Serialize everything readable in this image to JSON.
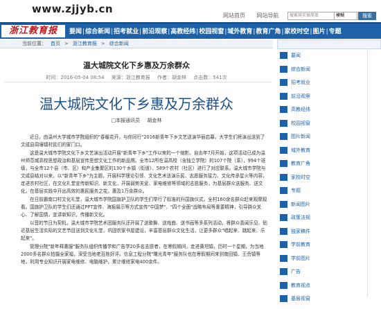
{
  "header": {
    "url_text": "www.zjjyb.cn",
    "links": [
      "网站首页",
      "网站导航"
    ],
    "search_placeholder": "搜索其实很简单",
    "search_select": "模糊",
    "search_button": "搜索"
  },
  "nav": {
    "logo_text": "浙江教育报",
    "items": [
      "要闻",
      "综合新闻",
      "招考就业",
      "前沿观察",
      "高教经纬",
      "校园视窗",
      "域外教育",
      "教育广角",
      "家校时空",
      "图片",
      "专题"
    ]
  },
  "breadcrumb": {
    "prefix": "当前位置：",
    "items": [
      "首页",
      ">",
      "浙江教育报",
      ">",
      "综合新闻"
    ]
  },
  "article": {
    "title_small": "温大城院文化下乡惠及万余群众",
    "meta": {
      "time": "时间：2016-05-04 08:54",
      "source": "来源：浙江教育报",
      "author": "作者：胡金林",
      "views": "点击数：541次"
    },
    "title_large": "温大城院文化下乡惠及万余群众",
    "byline": {
      "reporter": "□本报通讯员",
      "name": "胡金林"
    },
    "paragraphs": [
      "近日，由温州大学城市学院组织的\"春暖花开，与你同行\"2016新青年下乡文艺送演华丽启幕，大学生们将演出送到了文成县周壤镇村民们的家门口。",
      "这是温大城市学院文化下乡文艺演出活动开展\"新青年下乡\"工作以来的一个缩影。自去年7月开始，这项活动已成为温州师范城高校思想政治和基层宣传思想文化工作的新品牌。全市12所在温高校（含独立学院）的107个院（系），994个班级，与全市12个县（市、区）和产业集聚区的130个乡镇（街道）、589个农村（社区）进行了对应联系。温大城市学院与文成县结对以来，以\"新青年下乡\"为主题，开展科学理论引领、文化艺术送演乐民、志愿服务接力、文化传承星火等内容，走进农村社区，在文化礼堂宣传新知识、新文化，开展弱势关爱、家电维修等领域的志愿服务，为基层群众送服务、送文化，在基层实践中开出高效的惠民服务之花，惠及1万余群众。",
      "在日前霸南口村文化礼堂，温大城市学院国旗护卫队的学生们举行了标准的升国旗仪式，全村160余名群众赶来观摩观看。国旗护卫队的学生们还通过PPT宣传、海报展示等方式宣传\"中国梦\"、\"四个全面\"战略布局等重要精神，引导群众关心、了解国情，宣讲新知识，传播新文化。",
      "以音的节日为契机，温大城市学院艺术团服务队还开展了送歌舞、送戏曲、送书画等多系列活动，将群众喜闻乐见、贴近基层生活实际的文艺节目送到文化礼堂，巩固农家书屋建设，丰富基层群众文化生活，让更多群众\"唱起来、跳起来、乐起来\"。",
      "管理分院\"新年释惠服\"服务队组织传播学和广告学20多名志愿者，在寒假期间，走进黄坦镇，历时一个星期，为当地2000多名群众拍摄全家福，深受当地老百姓好评。信息工程分院\"曙光青年\"服务队也在寒假期间来到南田镇、王岙镇等地，利用专业知识开展家电维修、电脑维护，累计维修家电400余件。"
    ]
  },
  "sidebar": {
    "items": [
      "要闻",
      "综合新闻",
      "招考就业",
      "前沿观察",
      "高教经纬",
      "校园视窗",
      "图片新闻",
      "域外教育",
      "教育广角",
      "家校时空",
      "专题",
      "新闻图片",
      "政策法规",
      "独家稿件",
      "学前教育",
      "学前图片",
      "广告",
      "教育视点",
      "基层视窗"
    ]
  },
  "colors": {
    "nav_blue": "#1d62a8",
    "logo_red": "#c0151a",
    "title_blue": "#1d4f8a"
  }
}
